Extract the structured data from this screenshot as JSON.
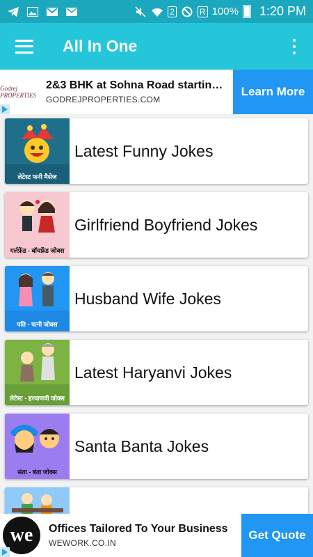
{
  "status_bar": {
    "battery_percent": "100%",
    "time": "1:20 PM",
    "sim_badge": "2",
    "roaming_badge": "R"
  },
  "app_bar": {
    "title": "All In One"
  },
  "ad_top": {
    "logo_text": "Godrej PROPERTIES",
    "headline": "2&3 BHK at Sohna Road startin…",
    "url": "GODREJPROPERTIES.COM",
    "button_label": "Learn More"
  },
  "categories": [
    {
      "title": "Latest Funny Jokes",
      "thumb_label": "लेटेस्ट फनी मैसेज",
      "thumb_color": "#1f6f8b",
      "icon": "jester-smiley-icon"
    },
    {
      "title": "Girlfriend Boyfriend Jokes",
      "thumb_label": "गर्लफ्रेंड - बॉयफ्रेंड जोक्स",
      "thumb_color": "#f8c8d0",
      "icon": "couple-icon"
    },
    {
      "title": "Husband Wife Jokes",
      "thumb_label": "पति - पत्नी जोक्स",
      "thumb_color": "#2196f3",
      "icon": "husband-wife-icon"
    },
    {
      "title": "Latest Haryanvi Jokes",
      "thumb_label": "लेटेस्ट - हरयाणवी जोक्स",
      "thumb_color": "#7cb342",
      "icon": "haryanvi-couple-icon"
    },
    {
      "title": "Santa Banta Jokes",
      "thumb_label": "संता - बंता जोक्स",
      "thumb_color": "#9c7df0",
      "icon": "santa-banta-icon"
    },
    {
      "title": "",
      "thumb_label": "",
      "thumb_color": "#90caf9",
      "icon": "people-icon"
    }
  ],
  "ad_bottom": {
    "logo_text": "we",
    "headline": "Offices Tailored To Your Business",
    "url": "WEWORK.CO.IN",
    "button_label": "Get Quote"
  }
}
